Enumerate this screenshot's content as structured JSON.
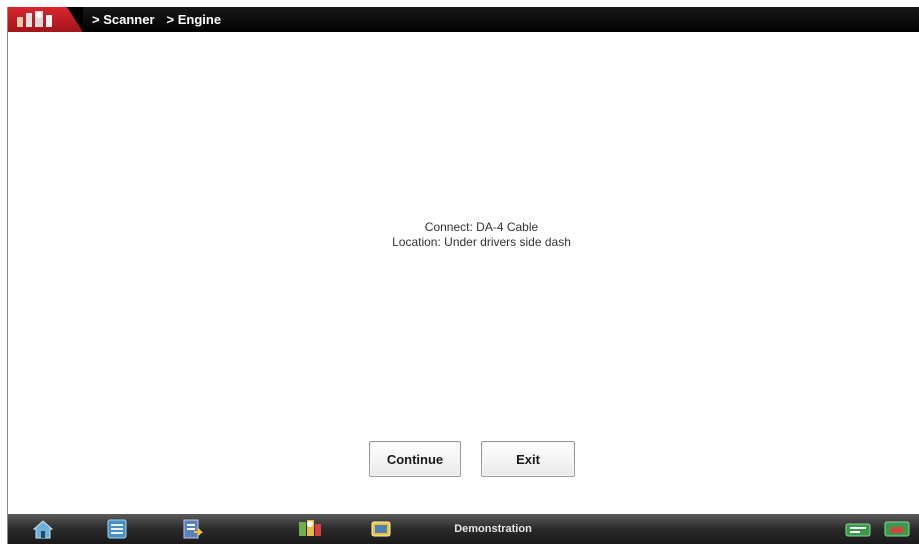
{
  "header": {
    "breadcrumbs": [
      "> Scanner",
      "> Engine"
    ]
  },
  "message": {
    "line1": "Connect: DA-4 Cable",
    "line2": "Location: Under drivers side dash"
  },
  "buttons": {
    "continue_label": "Continue",
    "exit_label": "Exit"
  },
  "toolbar": {
    "icons": [
      "home-icon",
      "tools-icon",
      "report-icon",
      "scanner-icon",
      "data-icon",
      "connection-icon",
      "battery-icon"
    ],
    "mode_label": "Demonstration"
  },
  "colors": {
    "header_bg": "#000000",
    "logo_red": "#c41d26",
    "toolbar_bg": "#2a2a2a"
  }
}
